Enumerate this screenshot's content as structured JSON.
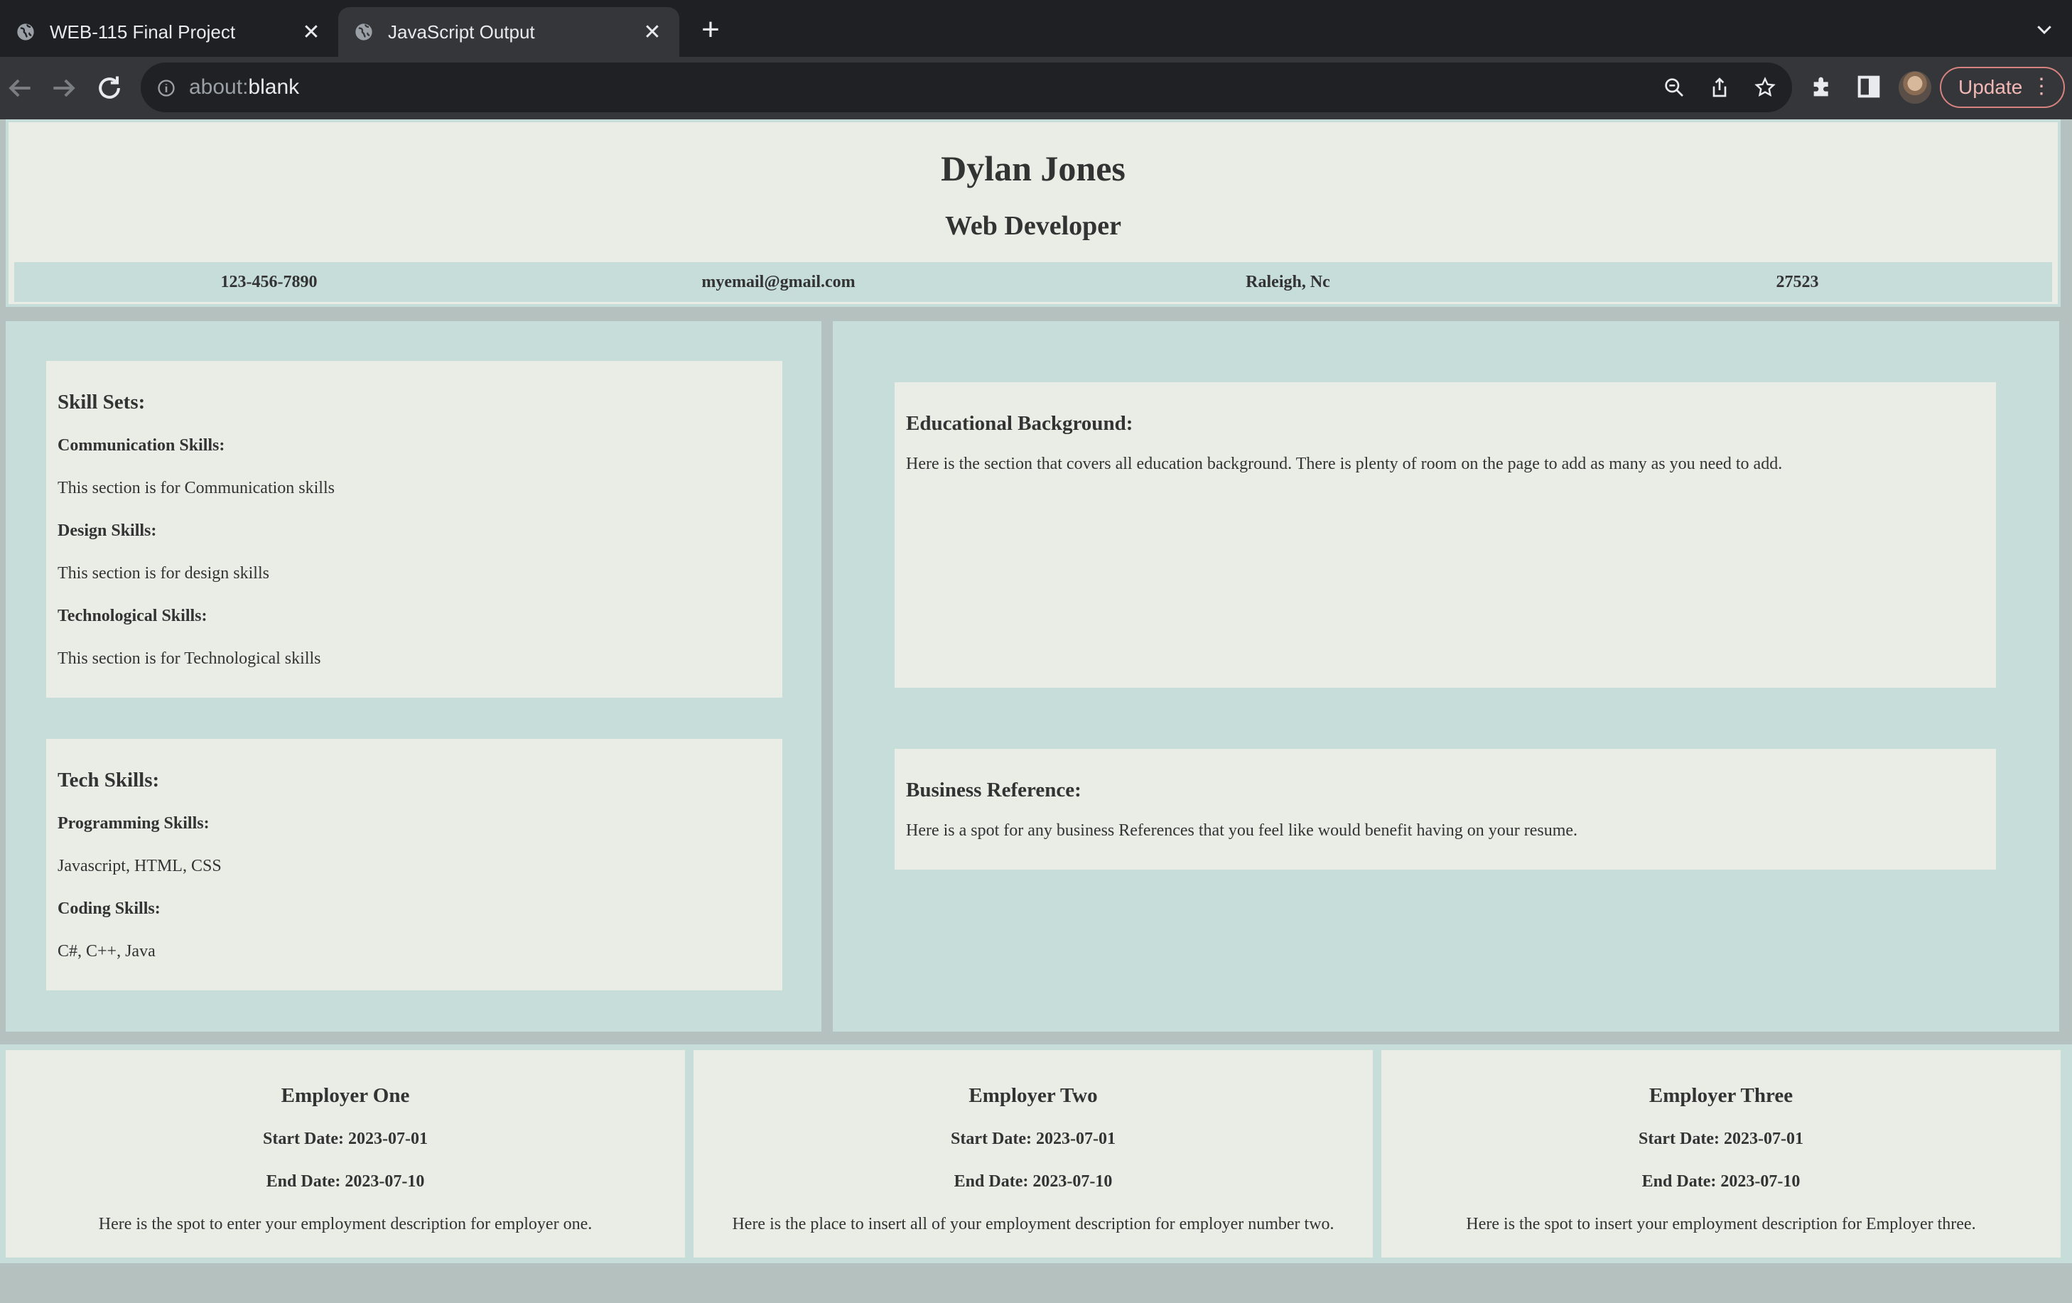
{
  "browser": {
    "tabs": [
      {
        "title": "WEB-115 Final Project",
        "active": false
      },
      {
        "title": "JavaScript Output",
        "active": true
      }
    ],
    "address": {
      "scheme": "about:",
      "path": "blank"
    },
    "update_label": "Update",
    "colors": {
      "tabbar": "#1f2024",
      "toolbar": "#35363a",
      "update_accent": "#f2b8b5"
    }
  },
  "resume": {
    "name": "Dylan Jones",
    "title": "Web Developer",
    "contact": {
      "phone": "123-456-7890",
      "email": "myemail@gmail.com",
      "location": "Raleigh, Nc",
      "zip": "27523"
    },
    "skill_sets": {
      "heading": "Skill Sets:",
      "groups": [
        {
          "title": "Communication Skills:",
          "text": "This section is for Communication skills"
        },
        {
          "title": "Design Skills:",
          "text": "This section is for design skills"
        },
        {
          "title": "Technological Skills:",
          "text": "This section is for Technological skills"
        }
      ]
    },
    "tech_skills": {
      "heading": "Tech Skills:",
      "groups": [
        {
          "title": "Programming Skills:",
          "text": "Javascript, HTML, CSS"
        },
        {
          "title": "Coding Skills:",
          "text": "C#, C++, Java"
        }
      ]
    },
    "education": {
      "heading": "Educational Background:",
      "text": "Here is the section that covers all education background. There is plenty of room on the page to add as many as you need to add."
    },
    "reference": {
      "heading": "Business Reference:",
      "text": "Here is a spot for any business References that you feel like would benefit having on your resume."
    },
    "employers": [
      {
        "name": "Employer One",
        "start": "Start Date: 2023-07-01",
        "end": "End Date: 2023-07-10",
        "description": "Here is the spot to enter your employment description for employer one."
      },
      {
        "name": "Employer Two",
        "start": "Start Date: 2023-07-01",
        "end": "End Date: 2023-07-10",
        "description": "Here is the place to insert all of your employment description for employer number two."
      },
      {
        "name": "Employer Three",
        "start": "Start Date: 2023-07-01",
        "end": "End Date: 2023-07-10",
        "description": "Here is the spot to insert your employment description for Employer three."
      }
    ],
    "colors": {
      "panel": "#eaece6",
      "accent": "#c6ddda",
      "page": "#b5c1be",
      "text": "#333333"
    }
  }
}
